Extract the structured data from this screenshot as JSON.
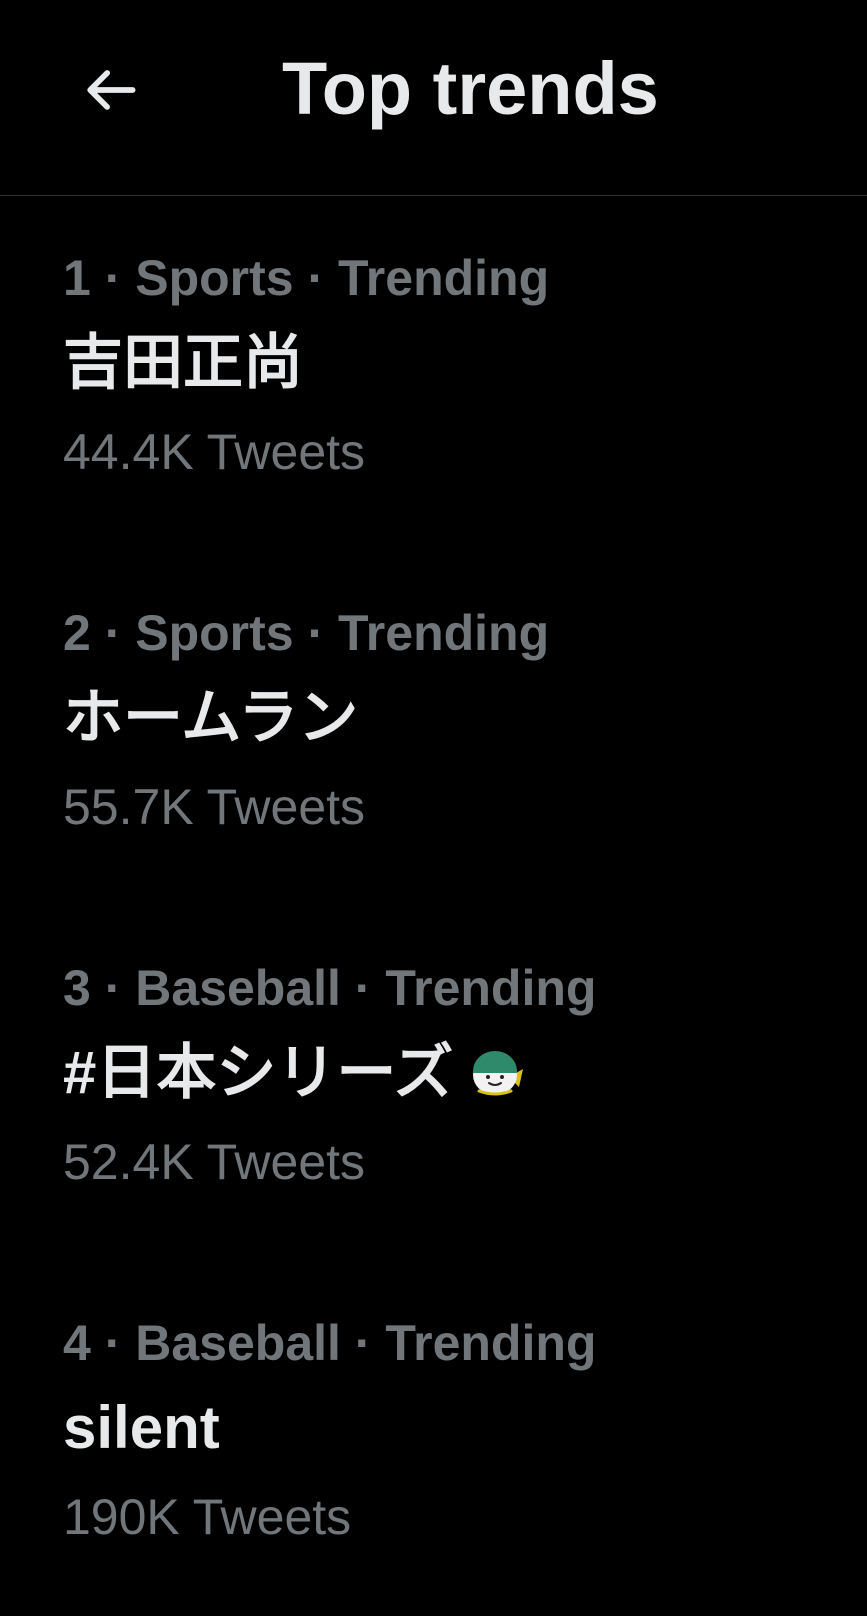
{
  "header": {
    "title": "Top trends",
    "back_icon": "arrow-left-icon"
  },
  "trends": [
    {
      "meta": "1 · Sports · Trending",
      "name": "吉田正尚",
      "count": "44.4K Tweets"
    },
    {
      "meta": "2 · Sports · Trending",
      "name": "ホームラン",
      "count": "55.7K Tweets"
    },
    {
      "meta": "3 · Baseball · Trending",
      "name": "#日本シリーズ",
      "icon": "hashflag-mascot-icon",
      "count": "52.4K Tweets"
    },
    {
      "meta": "4 · Baseball · Trending",
      "name": "silent",
      "count": "190K Tweets"
    }
  ],
  "colors": {
    "background": "#000000",
    "primary_text": "#e7e9ea",
    "secondary_text": "#71767b",
    "divider": "#2f3336"
  }
}
